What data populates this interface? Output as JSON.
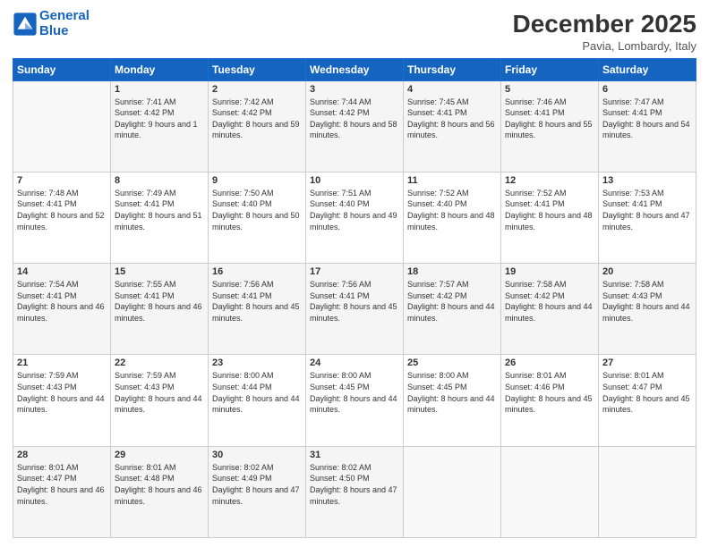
{
  "logo": {
    "line1": "General",
    "line2": "Blue"
  },
  "header": {
    "month": "December 2025",
    "location": "Pavia, Lombardy, Italy"
  },
  "days": [
    "Sunday",
    "Monday",
    "Tuesday",
    "Wednesday",
    "Thursday",
    "Friday",
    "Saturday"
  ],
  "weeks": [
    [
      {
        "num": "",
        "sunrise": "",
        "sunset": "",
        "daylight": ""
      },
      {
        "num": "1",
        "sunrise": "Sunrise: 7:41 AM",
        "sunset": "Sunset: 4:42 PM",
        "daylight": "Daylight: 9 hours and 1 minute."
      },
      {
        "num": "2",
        "sunrise": "Sunrise: 7:42 AM",
        "sunset": "Sunset: 4:42 PM",
        "daylight": "Daylight: 8 hours and 59 minutes."
      },
      {
        "num": "3",
        "sunrise": "Sunrise: 7:44 AM",
        "sunset": "Sunset: 4:42 PM",
        "daylight": "Daylight: 8 hours and 58 minutes."
      },
      {
        "num": "4",
        "sunrise": "Sunrise: 7:45 AM",
        "sunset": "Sunset: 4:41 PM",
        "daylight": "Daylight: 8 hours and 56 minutes."
      },
      {
        "num": "5",
        "sunrise": "Sunrise: 7:46 AM",
        "sunset": "Sunset: 4:41 PM",
        "daylight": "Daylight: 8 hours and 55 minutes."
      },
      {
        "num": "6",
        "sunrise": "Sunrise: 7:47 AM",
        "sunset": "Sunset: 4:41 PM",
        "daylight": "Daylight: 8 hours and 54 minutes."
      }
    ],
    [
      {
        "num": "7",
        "sunrise": "Sunrise: 7:48 AM",
        "sunset": "Sunset: 4:41 PM",
        "daylight": "Daylight: 8 hours and 52 minutes."
      },
      {
        "num": "8",
        "sunrise": "Sunrise: 7:49 AM",
        "sunset": "Sunset: 4:41 PM",
        "daylight": "Daylight: 8 hours and 51 minutes."
      },
      {
        "num": "9",
        "sunrise": "Sunrise: 7:50 AM",
        "sunset": "Sunset: 4:40 PM",
        "daylight": "Daylight: 8 hours and 50 minutes."
      },
      {
        "num": "10",
        "sunrise": "Sunrise: 7:51 AM",
        "sunset": "Sunset: 4:40 PM",
        "daylight": "Daylight: 8 hours and 49 minutes."
      },
      {
        "num": "11",
        "sunrise": "Sunrise: 7:52 AM",
        "sunset": "Sunset: 4:40 PM",
        "daylight": "Daylight: 8 hours and 48 minutes."
      },
      {
        "num": "12",
        "sunrise": "Sunrise: 7:52 AM",
        "sunset": "Sunset: 4:41 PM",
        "daylight": "Daylight: 8 hours and 48 minutes."
      },
      {
        "num": "13",
        "sunrise": "Sunrise: 7:53 AM",
        "sunset": "Sunset: 4:41 PM",
        "daylight": "Daylight: 8 hours and 47 minutes."
      }
    ],
    [
      {
        "num": "14",
        "sunrise": "Sunrise: 7:54 AM",
        "sunset": "Sunset: 4:41 PM",
        "daylight": "Daylight: 8 hours and 46 minutes."
      },
      {
        "num": "15",
        "sunrise": "Sunrise: 7:55 AM",
        "sunset": "Sunset: 4:41 PM",
        "daylight": "Daylight: 8 hours and 46 minutes."
      },
      {
        "num": "16",
        "sunrise": "Sunrise: 7:56 AM",
        "sunset": "Sunset: 4:41 PM",
        "daylight": "Daylight: 8 hours and 45 minutes."
      },
      {
        "num": "17",
        "sunrise": "Sunrise: 7:56 AM",
        "sunset": "Sunset: 4:41 PM",
        "daylight": "Daylight: 8 hours and 45 minutes."
      },
      {
        "num": "18",
        "sunrise": "Sunrise: 7:57 AM",
        "sunset": "Sunset: 4:42 PM",
        "daylight": "Daylight: 8 hours and 44 minutes."
      },
      {
        "num": "19",
        "sunrise": "Sunrise: 7:58 AM",
        "sunset": "Sunset: 4:42 PM",
        "daylight": "Daylight: 8 hours and 44 minutes."
      },
      {
        "num": "20",
        "sunrise": "Sunrise: 7:58 AM",
        "sunset": "Sunset: 4:43 PM",
        "daylight": "Daylight: 8 hours and 44 minutes."
      }
    ],
    [
      {
        "num": "21",
        "sunrise": "Sunrise: 7:59 AM",
        "sunset": "Sunset: 4:43 PM",
        "daylight": "Daylight: 8 hours and 44 minutes."
      },
      {
        "num": "22",
        "sunrise": "Sunrise: 7:59 AM",
        "sunset": "Sunset: 4:43 PM",
        "daylight": "Daylight: 8 hours and 44 minutes."
      },
      {
        "num": "23",
        "sunrise": "Sunrise: 8:00 AM",
        "sunset": "Sunset: 4:44 PM",
        "daylight": "Daylight: 8 hours and 44 minutes."
      },
      {
        "num": "24",
        "sunrise": "Sunrise: 8:00 AM",
        "sunset": "Sunset: 4:45 PM",
        "daylight": "Daylight: 8 hours and 44 minutes."
      },
      {
        "num": "25",
        "sunrise": "Sunrise: 8:00 AM",
        "sunset": "Sunset: 4:45 PM",
        "daylight": "Daylight: 8 hours and 44 minutes."
      },
      {
        "num": "26",
        "sunrise": "Sunrise: 8:01 AM",
        "sunset": "Sunset: 4:46 PM",
        "daylight": "Daylight: 8 hours and 45 minutes."
      },
      {
        "num": "27",
        "sunrise": "Sunrise: 8:01 AM",
        "sunset": "Sunset: 4:47 PM",
        "daylight": "Daylight: 8 hours and 45 minutes."
      }
    ],
    [
      {
        "num": "28",
        "sunrise": "Sunrise: 8:01 AM",
        "sunset": "Sunset: 4:47 PM",
        "daylight": "Daylight: 8 hours and 46 minutes."
      },
      {
        "num": "29",
        "sunrise": "Sunrise: 8:01 AM",
        "sunset": "Sunset: 4:48 PM",
        "daylight": "Daylight: 8 hours and 46 minutes."
      },
      {
        "num": "30",
        "sunrise": "Sunrise: 8:02 AM",
        "sunset": "Sunset: 4:49 PM",
        "daylight": "Daylight: 8 hours and 47 minutes."
      },
      {
        "num": "31",
        "sunrise": "Sunrise: 8:02 AM",
        "sunset": "Sunset: 4:50 PM",
        "daylight": "Daylight: 8 hours and 47 minutes."
      },
      {
        "num": "",
        "sunrise": "",
        "sunset": "",
        "daylight": ""
      },
      {
        "num": "",
        "sunrise": "",
        "sunset": "",
        "daylight": ""
      },
      {
        "num": "",
        "sunrise": "",
        "sunset": "",
        "daylight": ""
      }
    ]
  ]
}
